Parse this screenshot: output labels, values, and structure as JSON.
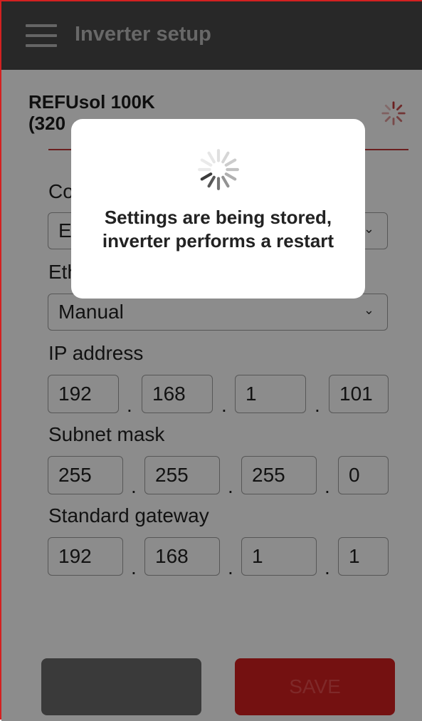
{
  "header": {
    "title": "Inverter setup"
  },
  "inverter": {
    "name": "REFUsol 100K\n(320"
  },
  "form": {
    "connection_label": "Co",
    "connection_value": "E",
    "ethernet_label": "Eth",
    "ethernet_value": "Manual",
    "ip_label": "IP address",
    "ip": [
      "192",
      "168",
      "1",
      "101"
    ],
    "subnet_label": "Subnet mask",
    "subnet": [
      "255",
      "255",
      "255",
      "0"
    ],
    "gateway_label": "Standard gateway",
    "gateway": [
      "192",
      "168",
      "1",
      "1"
    ],
    "separator": "."
  },
  "buttons": {
    "left_label": "",
    "save_label": "SAVE"
  },
  "dialog": {
    "message": "Settings are being stored, inverter performs a restart"
  },
  "colors": {
    "header": "#4a4a4a",
    "accent": "#d31f1f",
    "divider": "#c43a3a"
  }
}
